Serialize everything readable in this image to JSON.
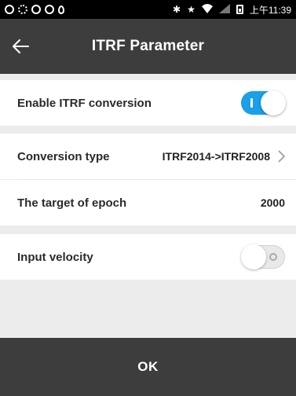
{
  "status_bar": {
    "time": "上午11:39",
    "left_icons": [
      "circle-sync-icon",
      "gear-icon",
      "sync-icon",
      "sync-icon",
      "location-pin-icon"
    ],
    "right_icons": [
      "bluetooth-icon",
      "star-icon",
      "wifi-icon",
      "signal-icon",
      "battery-icon"
    ]
  },
  "header": {
    "title": "ITRF Parameter",
    "back_icon": "arrow-left-icon"
  },
  "rows": {
    "enable_itrf": {
      "label": "Enable ITRF conversion",
      "toggle_state": "on"
    },
    "conversion_type": {
      "label": "Conversion type",
      "value": "ITRF2014->ITRF2008"
    },
    "target_epoch": {
      "label": "The target of epoch",
      "value": "2000"
    },
    "input_velocity": {
      "label": "Input velocity",
      "toggle_state": "off"
    }
  },
  "footer": {
    "ok_label": "OK"
  },
  "colors": {
    "header_bg": "#3d3d3d",
    "toggle_on": "#1a9fe8",
    "page_bg": "#ececec"
  }
}
